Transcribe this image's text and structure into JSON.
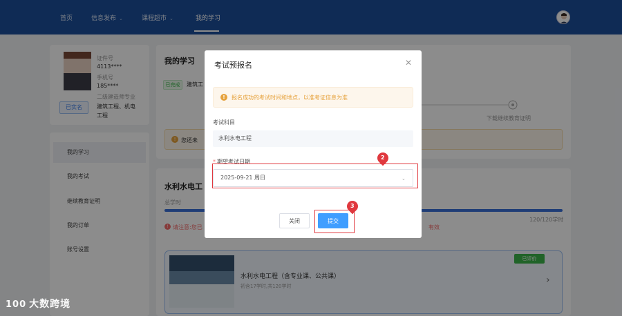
{
  "nav": {
    "items": [
      {
        "label": "首页"
      },
      {
        "label": "信息发布"
      },
      {
        "label": "课程超市"
      },
      {
        "label": "我的学习"
      }
    ]
  },
  "profile": {
    "id_label": "证件号",
    "id_value": "4113****",
    "phone_label": "手机号",
    "phone_value": "185****",
    "level": "二级建造师专业",
    "specialty_1": "建筑工程、机电",
    "specialty_2": "工程",
    "verified": "已实名"
  },
  "side_menu": {
    "items": [
      {
        "label": "我的学习"
      },
      {
        "label": "我的考试"
      },
      {
        "label": "继续教育证明"
      },
      {
        "label": "我的订单"
      },
      {
        "label": "账号设置"
      }
    ]
  },
  "study": {
    "title": "我的学习",
    "tag": "已完成",
    "tag_text": "建筑工",
    "step_label": "下载继续教育证明",
    "notice": "您还未"
  },
  "course": {
    "title": "水利水电工",
    "total_hours_label": "总学时",
    "hours_value": "120/120学时",
    "warning_left": "请注意:您已",
    "warning_right": "有效",
    "item_name": "水利水电工程（含专业课、公共课）",
    "item_sub": "初含17学时,共120学时",
    "rated": "已评价"
  },
  "modal": {
    "title": "考试预报名",
    "alert": "报名成功的考试时间和地点，以准考证信息为准",
    "subject_label": "考试科目",
    "subject_value": "水利水电工程",
    "date_required": "*",
    "date_label": "期望考试日期",
    "date_value": "2025-09-21 周日",
    "close_label": "关闭",
    "submit_label": "提交"
  },
  "annotations": {
    "step2": "2",
    "step3": "3"
  },
  "watermark": {
    "logo": "100",
    "text": "大数跨境"
  }
}
